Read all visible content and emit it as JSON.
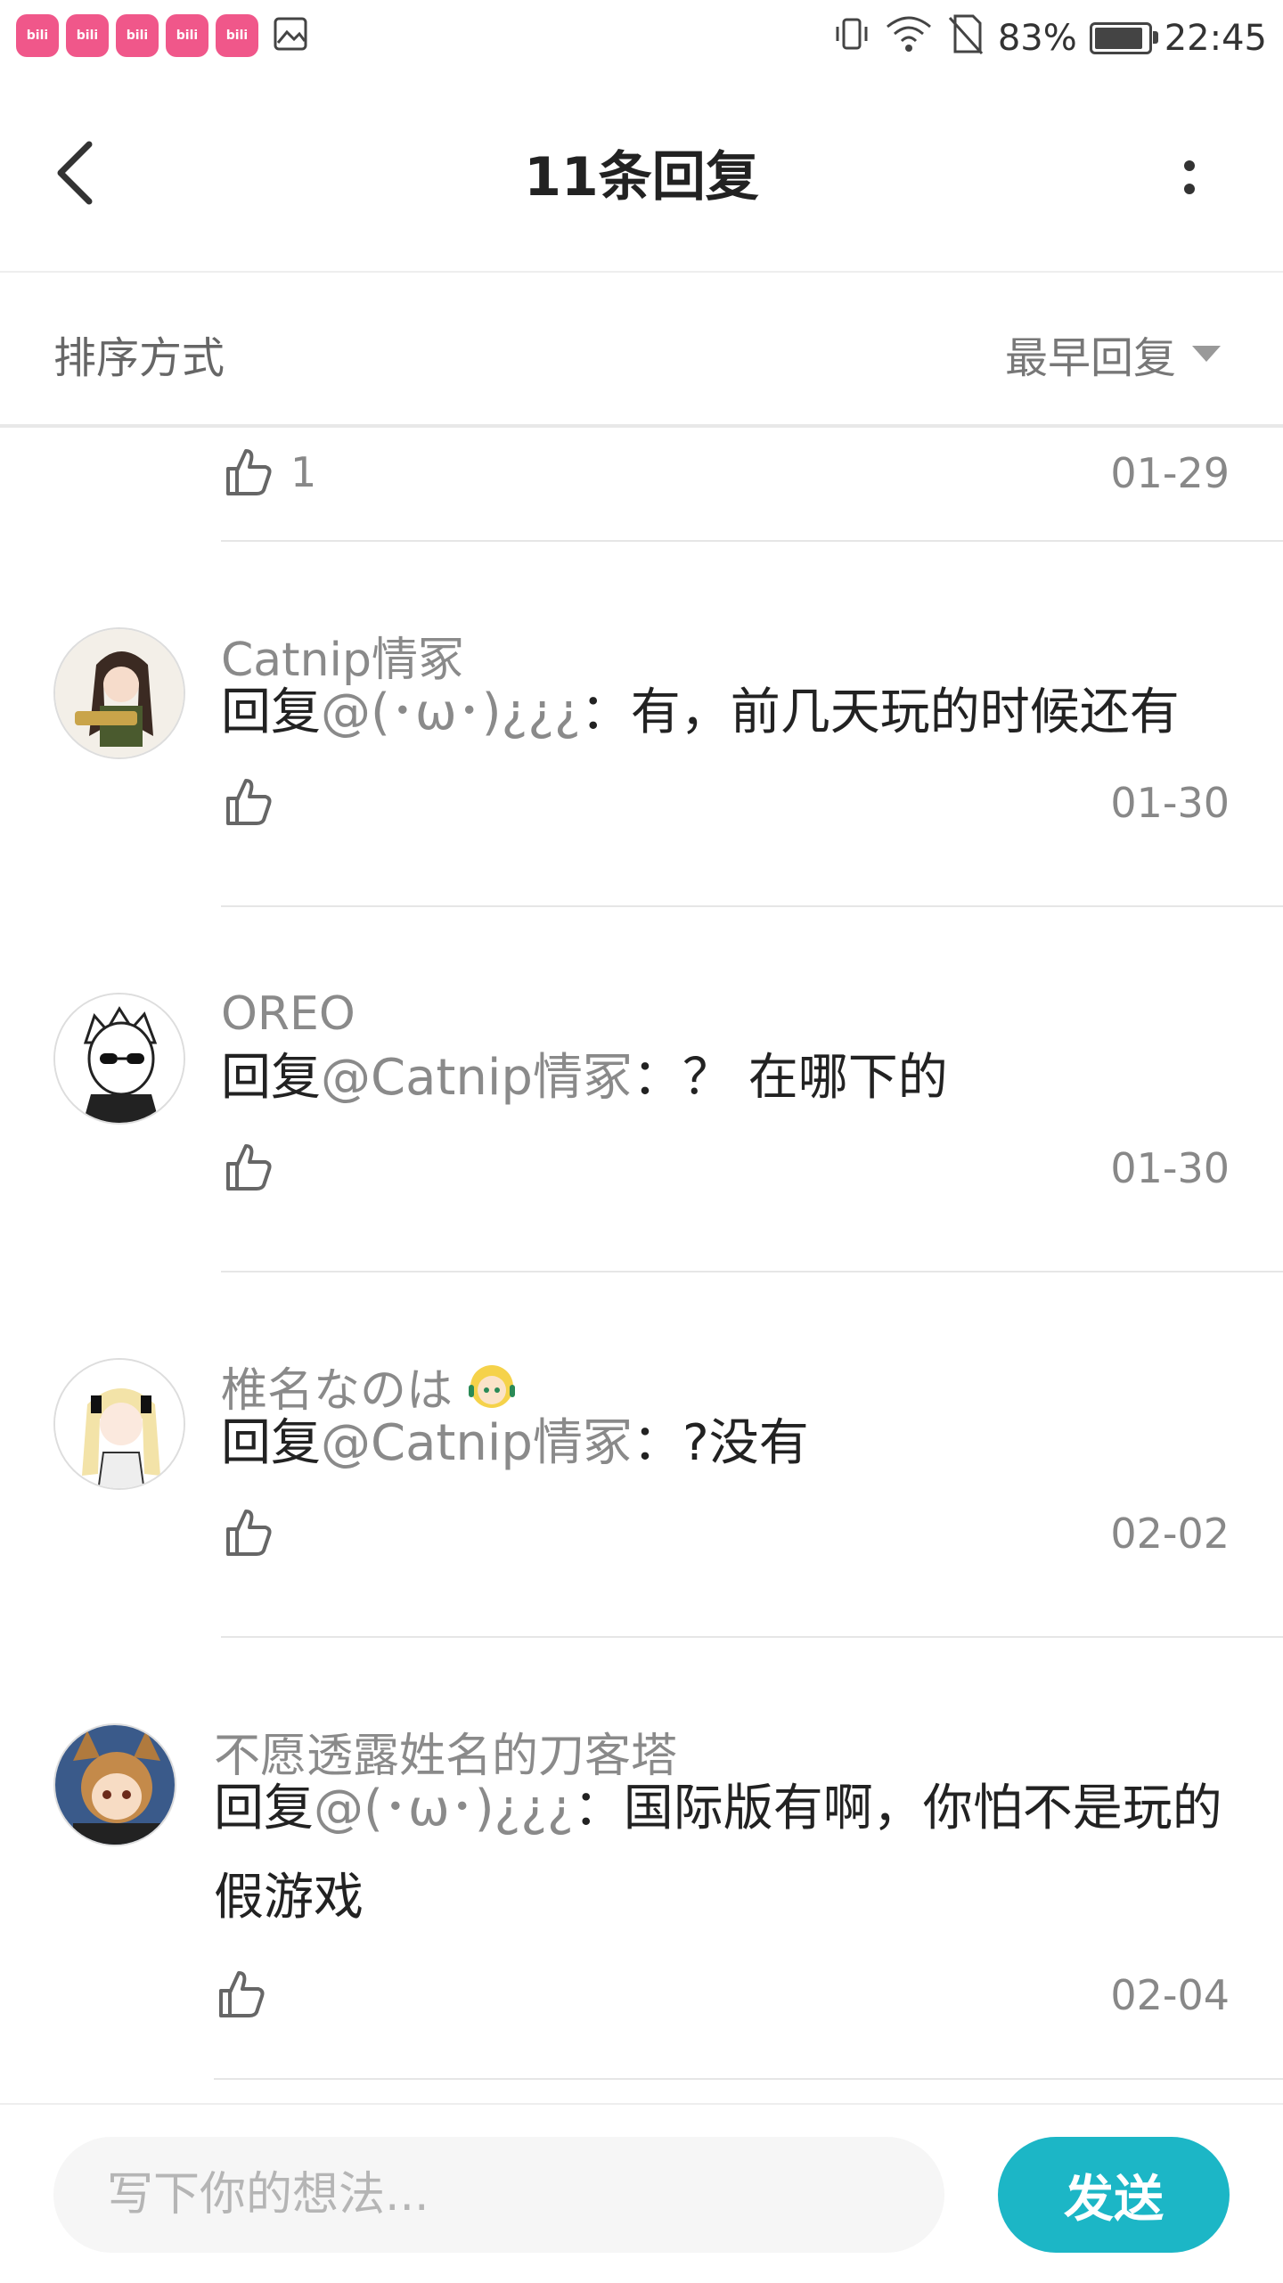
{
  "status_bar": {
    "app_icons": [
      "bilibili",
      "bilibili",
      "bilibili",
      "bilibili",
      "bilibili"
    ],
    "battery": "83%",
    "time": "22:45"
  },
  "header": {
    "title": "11条回复"
  },
  "sort": {
    "label": "排序方式",
    "selected": "最早回复"
  },
  "partial": {
    "likes": "1",
    "date": "01-29"
  },
  "comments": [
    {
      "username": "Catnip情冢",
      "prefix": "回复",
      "mention": "@(･ω･)¿¿¿",
      "text": "：有，前几天玩的时候还有",
      "date": "01-30"
    },
    {
      "username": "OREO",
      "prefix": "回复",
      "mention": "@Catnip情冢",
      "text": "：？ 在哪下的",
      "date": "01-30"
    },
    {
      "username": "椎名なのは",
      "prefix": "回复",
      "mention": "@Catnip情冢",
      "text": "：?没有",
      "date": "02-02"
    },
    {
      "username": "不愿透露姓名的刀客塔",
      "prefix": "回复",
      "mention": "@(･ω･)¿¿¿",
      "text": "：国际版有啊，你怕不是玩的假游戏",
      "date": "02-04"
    }
  ],
  "input": {
    "placeholder": "写下你的想法..."
  },
  "send_label": "发送",
  "colors": {
    "accent": "#1cb6c6",
    "bilibili_pink": "#f0578a"
  }
}
